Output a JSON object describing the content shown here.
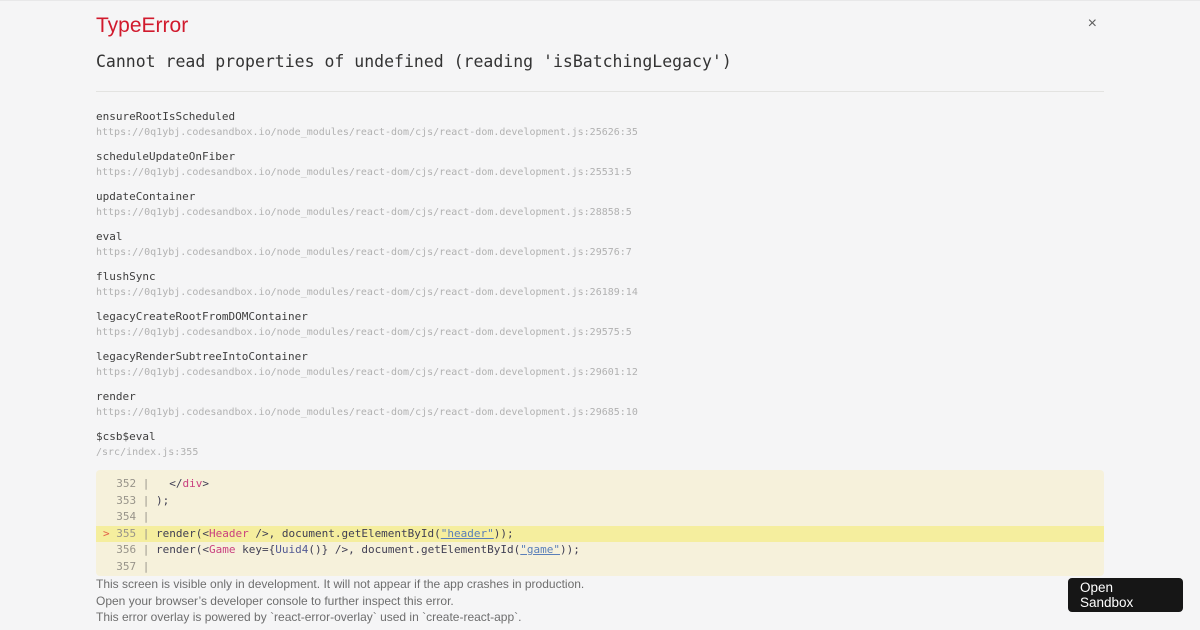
{
  "overlay": {
    "title": "TypeError",
    "close_label": "×",
    "message": "Cannot read properties of undefined (reading 'isBatchingLegacy')",
    "open_sandbox_label": "Open\nSandbox"
  },
  "stack_frames": [
    {
      "fn": "ensureRootIsScheduled",
      "location": "https://0q1ybj.codesandbox.io/node_modules/react-dom/cjs/react-dom.development.js:25626:35"
    },
    {
      "fn": "scheduleUpdateOnFiber",
      "location": "https://0q1ybj.codesandbox.io/node_modules/react-dom/cjs/react-dom.development.js:25531:5"
    },
    {
      "fn": "updateContainer",
      "location": "https://0q1ybj.codesandbox.io/node_modules/react-dom/cjs/react-dom.development.js:28858:5"
    },
    {
      "fn": "eval",
      "location": "https://0q1ybj.codesandbox.io/node_modules/react-dom/cjs/react-dom.development.js:29576:7"
    },
    {
      "fn": "flushSync",
      "location": "https://0q1ybj.codesandbox.io/node_modules/react-dom/cjs/react-dom.development.js:26189:14"
    },
    {
      "fn": "legacyCreateRootFromDOMContainer",
      "location": "https://0q1ybj.codesandbox.io/node_modules/react-dom/cjs/react-dom.development.js:29575:5"
    },
    {
      "fn": "legacyRenderSubtreeIntoContainer",
      "location": "https://0q1ybj.codesandbox.io/node_modules/react-dom/cjs/react-dom.development.js:29601:12"
    },
    {
      "fn": "render",
      "location": "https://0q1ybj.codesandbox.io/node_modules/react-dom/cjs/react-dom.development.js:29685:10"
    },
    {
      "fn": "$csb$eval",
      "location": "/src/index.js:355"
    }
  ],
  "code_frame": {
    "lines": [
      {
        "line": 352,
        "marker": false,
        "highlight": false,
        "tokens": [
          [
            "plain",
            "  </"
          ],
          [
            "tag",
            "div"
          ],
          [
            "plain",
            ">"
          ]
        ]
      },
      {
        "line": 353,
        "marker": false,
        "highlight": false,
        "tokens": [
          [
            "plain",
            ");"
          ]
        ]
      },
      {
        "line": 354,
        "marker": false,
        "highlight": false,
        "tokens": []
      },
      {
        "line": 355,
        "marker": true,
        "highlight": true,
        "tokens": [
          [
            "plain",
            "render(<"
          ],
          [
            "tag",
            "Header"
          ],
          [
            "plain",
            " />, document.getElementById("
          ],
          [
            "string",
            "\"header\""
          ],
          [
            "plain",
            "));"
          ]
        ]
      },
      {
        "line": 356,
        "marker": false,
        "highlight": false,
        "tokens": [
          [
            "plain",
            "render(<"
          ],
          [
            "tag",
            "Game"
          ],
          [
            "plain",
            " key={"
          ],
          [
            "capitalized",
            "Uuid4"
          ],
          [
            "plain",
            "()} />, document.getElementById("
          ],
          [
            "string",
            "\"game\""
          ],
          [
            "plain",
            "));"
          ]
        ]
      },
      {
        "line": 357,
        "marker": false,
        "highlight": false,
        "tokens": []
      }
    ]
  },
  "footer": {
    "lines": [
      "This screen is visible only in development. It will not appear if the app crashes in production.",
      "Open your browser’s developer console to further inspect this error.",
      "This error overlay is powered by `react-error-overlay` used in `create-react-app`."
    ]
  },
  "colors": {
    "accent_red": "#d11a2d",
    "code_bg": "#f6f1db",
    "code_highlight": "#f5ee9e",
    "code_marker": "#e36049",
    "code_tag": "#c9407f",
    "code_string": "#5a7fb9",
    "code_capitalized": "#525a93",
    "code_plain": "#403f53",
    "button_bg": "#161616"
  }
}
